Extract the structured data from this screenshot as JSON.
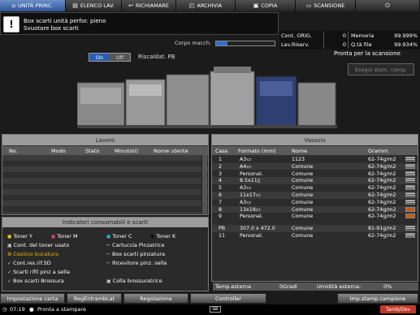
{
  "tabs": [
    {
      "label": "UNITÀ PRINC.",
      "icon": "home-icon",
      "glyph": "⌂"
    },
    {
      "label": "ELENCO LAV.",
      "icon": "job-list-icon",
      "glyph": "▤"
    },
    {
      "label": "RICHIAMARE",
      "icon": "recall-icon",
      "glyph": "↩"
    },
    {
      "label": "ARCHIVIA",
      "icon": "archive-icon",
      "glyph": "◰"
    },
    {
      "label": "COPIA",
      "icon": "copy-icon",
      "glyph": "▣"
    },
    {
      "label": "SCANSIONE",
      "icon": "scan-icon",
      "glyph": "▭"
    },
    {
      "label": "",
      "icon": "power-icon",
      "glyph": "⏻"
    }
  ],
  "message": {
    "line1": "Box scarti unità perfor. pieno",
    "line2": "Svuotare box scarti",
    "icon_glyph": "!"
  },
  "corpo": {
    "label": "Corpo macch.",
    "progress": 0.2
  },
  "counters": {
    "orig_label": "Cont. ORIG.",
    "orig_value": "0",
    "memoria_label": "Memoria",
    "memoria_value": "99.999%",
    "lav_label": "Lav.Riserv.",
    "lav_value": "0",
    "qta_label": "Q.tà file",
    "qta_value": "99.934%"
  },
  "status_ready": "Pronta per la scansione",
  "esegui_label": "Esegui stam. camp.",
  "heater": {
    "on": "On",
    "off": "Off",
    "label": "Riscaldat. PB"
  },
  "lavoro": {
    "title": "Lavoro",
    "cols": [
      "No.",
      "Modo",
      "Stato",
      "Minuto(i)",
      "Nome utente"
    ]
  },
  "indicatori": {
    "title": "Indicatori consumabili e scarti",
    "items": [
      {
        "label": "Toner Y",
        "g": "●",
        "c": "#e6c700"
      },
      {
        "label": "Toner M",
        "g": "●",
        "c": "#d0407a"
      },
      {
        "label": "Toner C",
        "g": "●",
        "c": "#2aa8e0"
      },
      {
        "label": "Toner K",
        "g": "●",
        "c": "#111111"
      },
      {
        "label": "Cont. del toner usato",
        "g": "▣",
        "c": "#cccccc"
      },
      {
        "label": "Cartuccia Pinzatrice",
        "g": "⌐",
        "c": "#cccccc"
      },
      {
        "label": "Cestino bucatura",
        "g": "♻",
        "c": "#f0b400"
      },
      {
        "label": "Box scarti pinzatura",
        "g": "⌐",
        "c": "#cccccc"
      },
      {
        "label": "Cont.res.rif.SD",
        "g": "✓",
        "c": "#cccccc"
      },
      {
        "label": "Ricevitore pinz. sella",
        "g": "⌐",
        "c": "#cccccc"
      },
      {
        "label": "Scarti rifil pinz a sella",
        "g": "✓",
        "c": "#cccccc"
      },
      {
        "label": "Box scarti Brossura",
        "g": "✓",
        "c": "#cccccc"
      },
      {
        "label": "Colla brossuratrice",
        "g": "▣",
        "c": "#cccccc"
      }
    ]
  },
  "vassoio": {
    "title": "Vassoio",
    "cols": [
      "Cass",
      "Formato (mm)",
      "Nome",
      "Gramm."
    ],
    "rows": [
      {
        "c": "1",
        "f": "A3▭",
        "n": "1123",
        "g": "62-74g/m2",
        "w": false
      },
      {
        "c": "2",
        "f": "A4▭",
        "n": "Comune",
        "g": "62-74g/m2",
        "w": false
      },
      {
        "c": "3",
        "f": "Personal.",
        "n": "Comune",
        "g": "62-74g/m2",
        "w": false
      },
      {
        "c": "4",
        "f": "8.5x11▯",
        "n": "Comune",
        "g": "62-74g/m2",
        "w": false
      },
      {
        "c": "5",
        "f": "A3▭",
        "n": "Comune",
        "g": "62-74g/m2",
        "w": false
      },
      {
        "c": "6",
        "f": "11x17▭",
        "n": "Comune",
        "g": "62-74g/m2",
        "w": false
      },
      {
        "c": "7",
        "f": "A3▭",
        "n": "Comune",
        "g": "62-74g/m2",
        "w": false
      },
      {
        "c": "8",
        "f": "13x19▭",
        "n": "Comune",
        "g": "62-74g/m2",
        "w": true
      },
      {
        "c": "9",
        "f": "Personal.",
        "n": "Comune",
        "g": "62-74g/m2",
        "w": true
      },
      {
        "c": "PB",
        "f": "307.0 x 472.0",
        "n": "Comune",
        "g": "81-91g/m2",
        "w": false
      },
      {
        "c": "11",
        "f": "Personal.",
        "n": "Comune",
        "g": "62-74g/m2",
        "w": false
      }
    ]
  },
  "temp": {
    "label": "Temp.esterna",
    "value": "0Gradi",
    "hum_label": "Umidità esterna:",
    "hum_value": "0%"
  },
  "buttons": {
    "imp_carta": "Impostazione carta",
    "reg_entramb": "RegEntrambLat",
    "regolazione": "Regolazione",
    "controller": "Controller",
    "imp_stamp": "Imp.stamp.campione"
  },
  "statusbar": {
    "time": "07:19",
    "text": "Pronta a stampare",
    "badge": "Tamb/Dev"
  }
}
